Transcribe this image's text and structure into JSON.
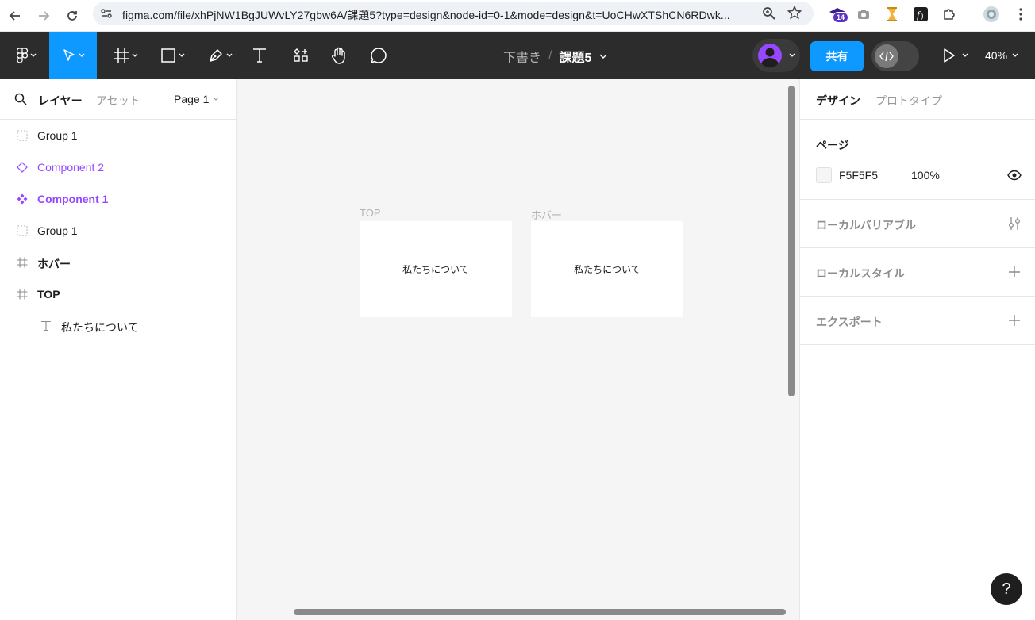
{
  "browser": {
    "url": "figma.com/file/xhPjNW1BgJUWvLY27gbw6A/課題5?type=design&node-id=0-1&mode=design&t=UoCHwXTShCN6RDwk...",
    "extension_badge": "14"
  },
  "toolbar": {
    "draft_label": "下書き",
    "separator": "/",
    "file_name": "課題5",
    "share_label": "共有",
    "zoom_label": "40%"
  },
  "left_panel": {
    "tab_layers": "レイヤー",
    "tab_assets": "アセット",
    "page_selector": "Page 1",
    "layers": [
      {
        "label": "Group 1",
        "icon": "group-icon"
      },
      {
        "label": "Component 2",
        "icon": "component-instance-icon"
      },
      {
        "label": "Component 1",
        "icon": "component-icon"
      },
      {
        "label": "Group 1",
        "icon": "group-icon"
      },
      {
        "label": "ホバー",
        "icon": "frame-icon"
      },
      {
        "label": "TOP",
        "icon": "frame-icon"
      },
      {
        "label": "私たちについて",
        "icon": "text-icon"
      }
    ]
  },
  "canvas": {
    "background": "#F5F5F5",
    "frames": [
      {
        "label": "TOP",
        "text": "私たちについて"
      },
      {
        "label": "ホバー",
        "text": "私たちについて"
      }
    ]
  },
  "right_panel": {
    "tab_design": "デザイン",
    "tab_prototype": "プロトタイプ",
    "page_section_title": "ページ",
    "page_color": "F5F5F5",
    "page_opacity": "100%",
    "local_variables": "ローカルバリアブル",
    "local_styles": "ローカルスタイル",
    "export": "エクスポート"
  },
  "help_label": "?",
  "colors": {
    "accent": "#0D99FF",
    "component": "#9747FF",
    "toolbar_bg": "#2C2C2C"
  }
}
